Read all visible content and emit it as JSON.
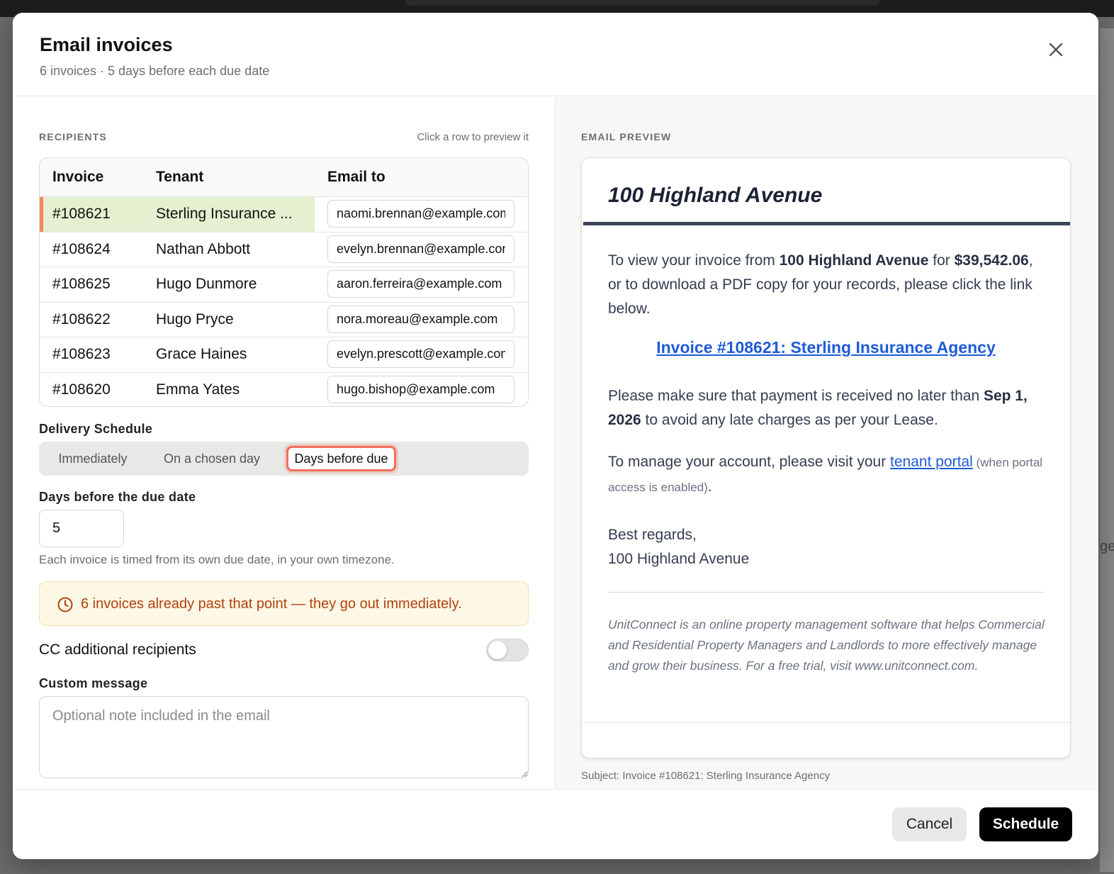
{
  "dialog": {
    "title": "Email invoices",
    "subtitle": "6 invoices · 5 days before each due date"
  },
  "recipients": {
    "section_label": "RECIPIENTS",
    "hint": "Click a row to preview it",
    "columns": [
      "Invoice",
      "Tenant",
      "Email to"
    ],
    "rows": [
      {
        "invoice": "#108621",
        "tenant": "Sterling Insurance ...",
        "email": "naomi.brennan@example.com",
        "selected": true
      },
      {
        "invoice": "#108624",
        "tenant": "Nathan Abbott",
        "email": "evelyn.brennan@example.com",
        "selected": false
      },
      {
        "invoice": "#108625",
        "tenant": "Hugo Dunmore",
        "email": "aaron.ferreira@example.com",
        "selected": false
      },
      {
        "invoice": "#108622",
        "tenant": "Hugo Pryce",
        "email": "nora.moreau@example.com",
        "selected": false
      },
      {
        "invoice": "#108623",
        "tenant": "Grace Haines",
        "email": "evelyn.prescott@example.com",
        "selected": false
      },
      {
        "invoice": "#108620",
        "tenant": "Emma Yates",
        "email": "hugo.bishop@example.com",
        "selected": false
      }
    ],
    "selected_color": "#e4f0cf",
    "selected_marker_color": "#f08a5d"
  },
  "delivery": {
    "label": "Delivery Schedule",
    "options": [
      "Immediately",
      "On a chosen day",
      "Days before due"
    ],
    "selected": "Days before due",
    "days_label": "Days before the due date",
    "days_value": "5",
    "help": "Each invoice is timed from its own due date, in your own timezone.",
    "warning": "6 invoices already past that point — they go out immediately.",
    "warning_icon": "clock-icon"
  },
  "cc": {
    "label": "CC additional recipients",
    "enabled": false
  },
  "custom_message": {
    "label": "Custom message",
    "placeholder": "Optional note included in the email",
    "value": ""
  },
  "preview": {
    "section_label": "EMAIL PREVIEW",
    "heading": "100 Highland Avenue",
    "p1_pre": "To view your invoice from ",
    "p1_property": "100 Highland Avenue",
    "p1_mid": " for ",
    "p1_amount": "$39,542.06",
    "p1_post": ", or to download a PDF copy for your records, please click the link below.",
    "invoice_link": "Invoice #108621: Sterling Insurance Agency",
    "p2_pre": "Please make sure that payment is received no later than ",
    "p2_date": "Sep 1, 2026",
    "p2_post": " to avoid any late charges as per your Lease.",
    "p3_pre": "To manage your account, please visit your ",
    "p3_link": "tenant portal",
    "p3_small": " (when portal access is enabled)",
    "p3_post": ".",
    "signoff": "Best regards,",
    "signature": "100 Highland Avenue",
    "footer": "UnitConnect is an online property management software that helps Commercial and Residential Property Managers and Landlords to more effectively manage and grow their business. For a free trial, visit www.unitconnect.com.",
    "subject": "Subject: Invoice #108621: Sterling Insurance Agency"
  },
  "actions": {
    "cancel": "Cancel",
    "schedule": "Schedule"
  },
  "colors": {
    "accent_focus": "#f0715a",
    "link": "#1f5bd6",
    "warning_text": "#b2410c",
    "warning_bg": "#fdf8e5"
  }
}
